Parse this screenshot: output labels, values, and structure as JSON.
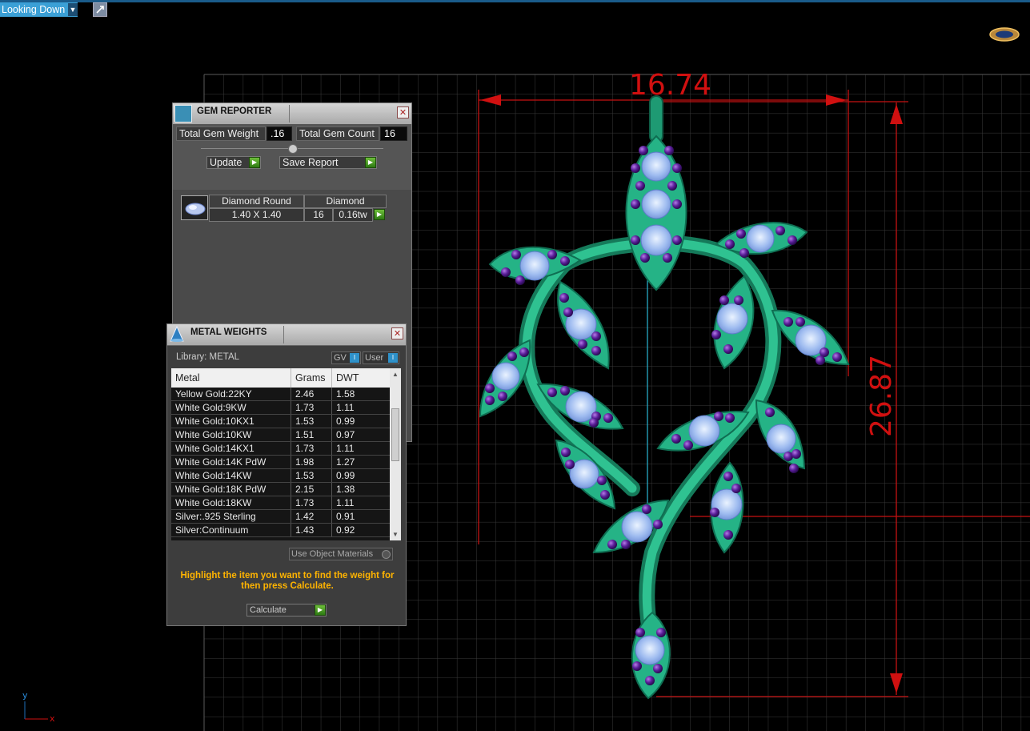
{
  "view": {
    "label": "Looking Down"
  },
  "dimensions": {
    "width_value": "16.74",
    "height_value": "26.87"
  },
  "axis": {
    "y": "y",
    "x": "x"
  },
  "gem_reporter": {
    "title": "GEM REPORTER",
    "total_weight_label": "Total Gem Weight",
    "total_weight_value": ".16",
    "total_count_label": "Total Gem Count",
    "total_count_value": "16",
    "update_label": "Update",
    "save_label": "Save Report",
    "gem_row": {
      "shape": "Diamond Round",
      "material": "Diamond",
      "size": "1.40 X 1.40",
      "count": "16",
      "weight": "0.16tw"
    }
  },
  "metal_weights": {
    "title": "METAL WEIGHTS",
    "library_label": "Library: METAL",
    "gv_label": "GV",
    "user_label": "User",
    "columns": [
      "Metal",
      "Grams",
      "DWT"
    ],
    "rows": [
      [
        "Yellow Gold:22KY",
        "2.46",
        "1.58"
      ],
      [
        "White Gold:9KW",
        "1.73",
        "1.11"
      ],
      [
        "White Gold:10KX1",
        "1.53",
        "0.99"
      ],
      [
        "White Gold:10KW",
        "1.51",
        "0.97"
      ],
      [
        "White Gold:14KX1",
        "1.73",
        "1.11"
      ],
      [
        "White Gold:14K PdW",
        "1.98",
        "1.27"
      ],
      [
        "White Gold:14KW",
        "1.53",
        "0.99"
      ],
      [
        "White Gold:18K PdW",
        "2.15",
        "1.38"
      ],
      [
        "White Gold:18KW",
        "1.73",
        "1.11"
      ],
      [
        "Silver:.925 Sterling",
        "1.42",
        "0.91"
      ],
      [
        "Silver:Continuum",
        "1.43",
        "0.92"
      ]
    ],
    "use_object_materials": "Use Object Materials",
    "hint": "Highlight the item you want to find the weight for then press Calculate.",
    "calculate_label": "Calculate"
  },
  "colors": {
    "accent": "#3ba0d6",
    "dimension": "#d01010",
    "metal": "#1fa57c",
    "gem": "#a9c7f5",
    "accent_gem": "#6a2aa8",
    "hint": "#ffb400"
  }
}
